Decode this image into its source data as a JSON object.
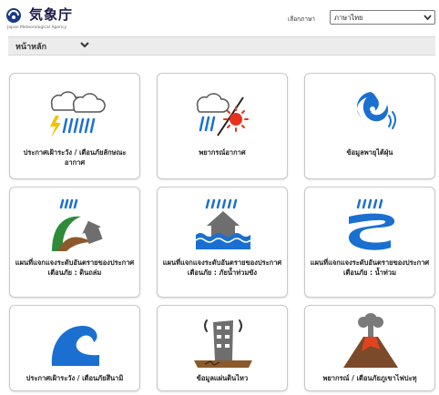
{
  "header": {
    "logo_text": "気象庁",
    "logo_sub": "Japan Meteorological Agency",
    "lang_label": "เลือกภาษา",
    "lang_value": "ภาษาไทย"
  },
  "nav": {
    "home_label": "หน้าหลัก"
  },
  "tiles": [
    {
      "label": "ประกาศเฝ้าระวัง / เตือนภัยลักษณะอากาศ",
      "icon": "rain-cloud-lightning-icon"
    },
    {
      "label": "พยากรณ์อากาศ",
      "icon": "cloud-rain-sun-icon"
    },
    {
      "label": "ข้อมูลพายุไต้ฝุ่น",
      "icon": "typhoon-icon"
    },
    {
      "label": "แผนที่แจกแจงระดับอันตรายของประกาศเตือนภัย : ดินถล่ม",
      "icon": "landslide-icon"
    },
    {
      "label": "แผนที่แจกแจงระดับอันตรายของประกาศเตือนภัย : ภัยน้ำท่วมขัง",
      "icon": "flood-house-icon"
    },
    {
      "label": "แผนที่แจกแจงระดับอันตรายของประกาศเตือนภัย : น้ำท่วม",
      "icon": "river-flood-icon"
    },
    {
      "label": "ประกาศเฝ้าระวัง / เตือนภัยสึนามิ",
      "icon": "tsunami-icon"
    },
    {
      "label": "ข้อมูลแผ่นดินไหว",
      "icon": "earthquake-icon"
    },
    {
      "label": "พยากรณ์ / เตือนภัยภูเขาไฟปะทุ",
      "icon": "volcano-icon"
    }
  ],
  "colors": {
    "accent_blue": "#1a6fd1",
    "warning_yellow": "#f2c200",
    "sun_red": "#e8321e",
    "landslide_green": "#2e8b3a",
    "landslide_brown": "#8b5a2b",
    "house_gray": "#6e6e6e",
    "volcano_brown": "#7a4a2a",
    "lava": "#e2431f"
  }
}
